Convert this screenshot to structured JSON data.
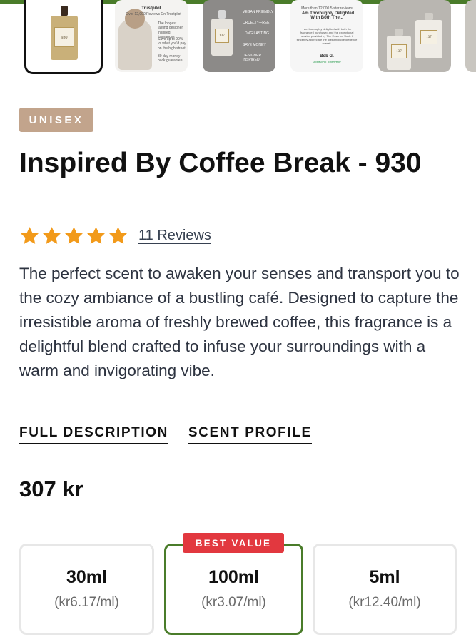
{
  "gallery": {
    "thumb_1": {
      "bottle_number": "930"
    },
    "thumb_2": {
      "header": "Trustpilot",
      "subheader": "Over 12,000 Reviews On Trustpilot",
      "points": [
        "The longest lasting designer inspired fragrances",
        "Save up to 90% vs what you'd pay on the high street",
        "30 day money back guarantee"
      ]
    },
    "thumb_3": {
      "bottle_number": "137",
      "features": [
        "VEGAN FRIENDLY",
        "CRUELTY-FREE",
        "LONG LASTING",
        "SAVE MONEY",
        "DESIGNER INSPIRED"
      ]
    },
    "thumb_4": {
      "header": "More than 12,000 5-star reviews",
      "quote_title": "I Am Thoroughly Delighted With Both The...",
      "quote_body": "I am thoroughly delighted with both the fragrance I purchased and the exceptional service provided by The Essence Vault. I sincerely appreciate the outstanding experience overall.",
      "author": "Bob G.",
      "verified": "Verified Customer"
    },
    "thumb_5": {
      "bottle_number": "137",
      "bottle_number_2": "137"
    }
  },
  "product": {
    "badge": "UNISEX",
    "title": "Inspired By Coffee Break - 930",
    "rating": 5,
    "reviews_label": "11 Reviews",
    "description": "The perfect scent to awaken your senses and transport you to the cozy ambiance of a bustling café. Designed to capture the irresistible aroma of freshly brewed coffee, this fragrance is a delightful blend crafted to infuse your surroundings with a warm and invigorating vibe.",
    "links": {
      "full_description": "FULL DESCRIPTION",
      "scent_profile": "SCENT PROFILE"
    },
    "price": "307 kr"
  },
  "options": [
    {
      "size": "30ml",
      "per_ml": "(kr6.17/ml)",
      "selected": false
    },
    {
      "size": "100ml",
      "per_ml": "(kr3.07/ml)",
      "selected": true
    },
    {
      "size": "5ml",
      "per_ml": "(kr12.40/ml)",
      "selected": false
    }
  ],
  "best_value_label": "BEST VALUE",
  "colors": {
    "accent_green": "#4a7c2a",
    "badge_tan": "#c2a48c",
    "star_orange": "#f29a1a",
    "best_value_red": "#e2383f"
  }
}
